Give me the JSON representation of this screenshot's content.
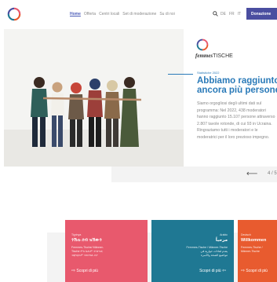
{
  "header": {
    "nav": [
      "Home",
      "Offerta",
      "Centri locali",
      "Set di moderazione",
      "Su di noi"
    ],
    "languages": [
      "DE",
      "FR",
      "IT"
    ],
    "donate_label": "Donazione"
  },
  "hero": {
    "brand_prefix": "femmes",
    "brand_suffix": "TISCHE",
    "kicker": "Statistiche 2022",
    "title_lines": [
      "Abbiamo raggiunto",
      "ancora più persone"
    ],
    "body_lines": [
      "Siamo orgogliosi degli ultimi dati sul",
      "programma: Nel 2022, 438 moderatori",
      "hanno raggiunto 15.107 persone attraverso",
      "2.807 tavole rotonde, di cui 93 in Ucraina.",
      "Ringraziamo tutti i moderatori e le",
      "moderatrici per il loro prezioso impegno."
    ],
    "prev_label": "⟵",
    "next_label": "4 / 5"
  },
  "cards": [
    {
      "small": "Tigrinya",
      "heading": "ንኹሉ ሰብ ዝኸውን",
      "body_lines": [
        "Femmes-Tische/ Männer-",
        "Tische ምስ ኩሎም ተሳተፍቲ",
        "ብቋንቋኦም ዝዝተዩሉ ቦታ"
      ],
      "more": "Scopri di più"
    },
    {
      "small": "Arabic",
      "heading": "مرحباً",
      "body_lines": [
        "Femmes-Tische / Männer-Tische",
        "يقدم لقاءات حوارية في",
        "مواضيع الصحة والأسرة"
      ],
      "more": "Scopri di più"
    },
    {
      "small": "Deutsch",
      "heading": "Willkommen",
      "body_lines": [
        "Femmes-Tische /",
        "Männer-Tische"
      ],
      "more": "Scopri di più"
    }
  ],
  "colors": {
    "accent": "#2a7ab8",
    "donate": "#4a4ea0",
    "card_pink": "#e8596d",
    "card_teal": "#1f7893",
    "card_orange": "#e85b2f"
  }
}
